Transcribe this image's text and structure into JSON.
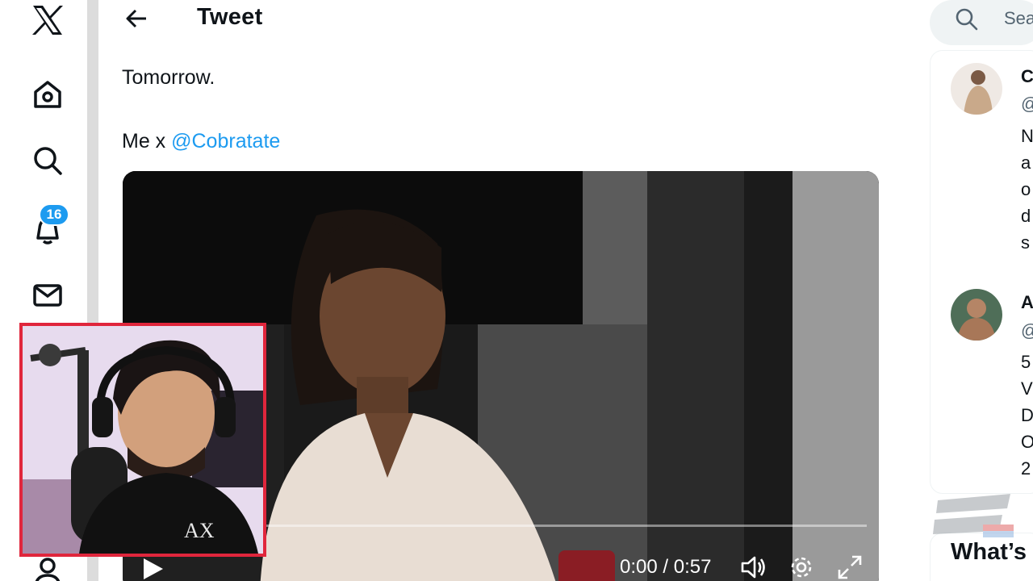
{
  "nav": {
    "items": [
      {
        "name": "x-logo-icon"
      },
      {
        "name": "home-icon"
      },
      {
        "name": "explore-icon"
      },
      {
        "name": "notifications-icon"
      },
      {
        "name": "messages-icon"
      },
      {
        "name": "profile-icon"
      }
    ],
    "notifications_badge": "16"
  },
  "header": {
    "title": "Tweet"
  },
  "tweet": {
    "line1": "Tomorrow.",
    "line2_prefix": "Me x ",
    "mention": "@Cobratate"
  },
  "video": {
    "time": "0:00 / 0:57",
    "progress": 0.0
  },
  "sidebar": {
    "search_placeholder": "Sea",
    "recommendations": [
      {
        "name": "C",
        "handle": "@",
        "lines": [
          "N",
          "a",
          "o",
          "d",
          "s"
        ]
      },
      {
        "name": "A",
        "handle": "@",
        "lines": [
          "5",
          "V",
          "D",
          "O",
          "2"
        ]
      }
    ],
    "whats_happening": "What’s"
  },
  "colors": {
    "accent": "#1d9bf0",
    "webcam_border": "#e0263c"
  }
}
